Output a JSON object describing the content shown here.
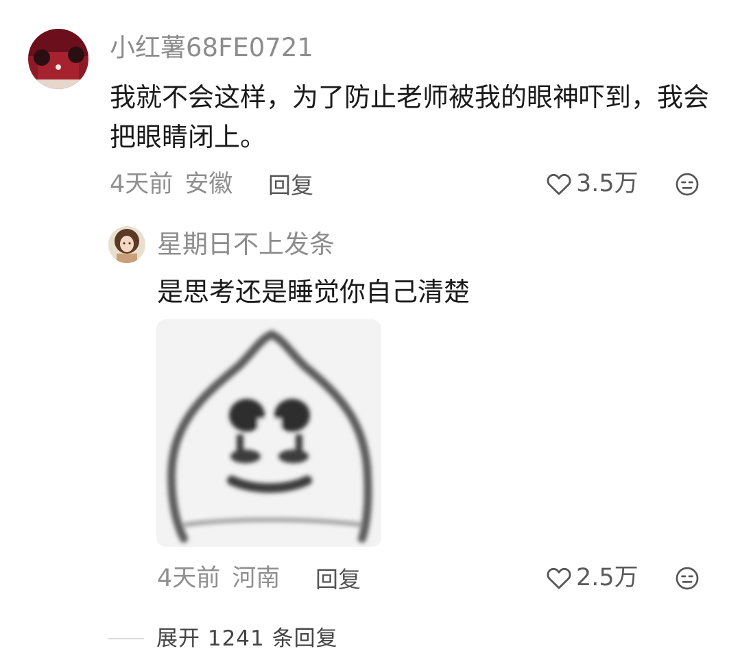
{
  "comment": {
    "username": "小红薯68FE0721",
    "text": "我就不会这样，为了防止老师被我的眼神吓到，我会把眼睛闭上。",
    "time": "4天前",
    "location": "安徽",
    "reply_label": "回复",
    "like_count": "3.5万",
    "icons": {
      "like": "heart-outline-icon",
      "dislike": "meh-face-icon"
    }
  },
  "reply": {
    "username": "星期日不上发条",
    "text": "是思考还是睡觉你自己清楚",
    "sticker": "blurry-blob-face-sticker",
    "time": "4天前",
    "location": "河南",
    "reply_label": "回复",
    "like_count": "2.5万"
  },
  "expand": {
    "label": "展开 1241 条回复"
  },
  "colors": {
    "username": "#8c8c8c",
    "text": "#1a1a1a",
    "meta": "#8f8f8f",
    "background": "#ffffff"
  }
}
